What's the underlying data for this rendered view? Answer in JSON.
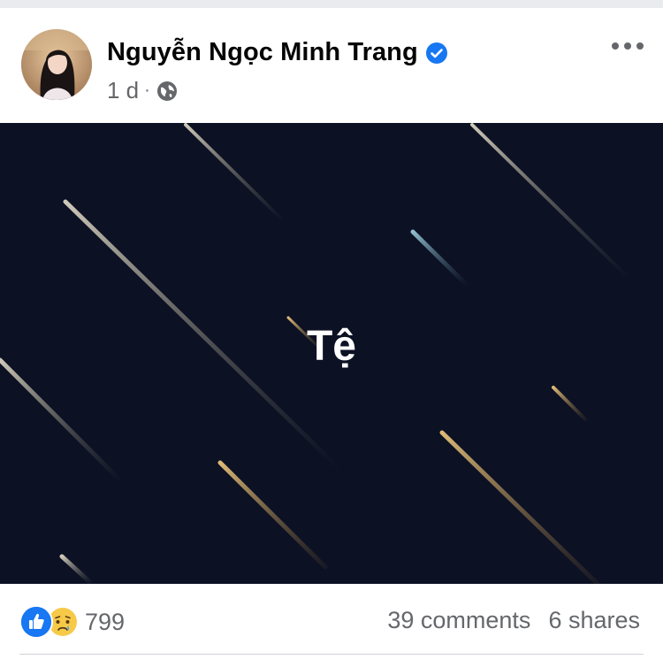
{
  "post": {
    "author_name": "Nguyễn Ngọc Minh Trang",
    "time": "1 d",
    "separator": "·",
    "text": "Tệ",
    "background_color": "#0c1124"
  },
  "icons": {
    "verified": "verified-badge-icon",
    "audience": "globe-icon",
    "more": "more-options-icon",
    "like": "like-reaction-icon",
    "sad": "sad-reaction-icon"
  },
  "engagement": {
    "reaction_count": "799",
    "comments": "39 comments",
    "shares": "6 shares"
  },
  "colors": {
    "brand_blue": "#1877f2",
    "secondary_text": "#65676b"
  }
}
